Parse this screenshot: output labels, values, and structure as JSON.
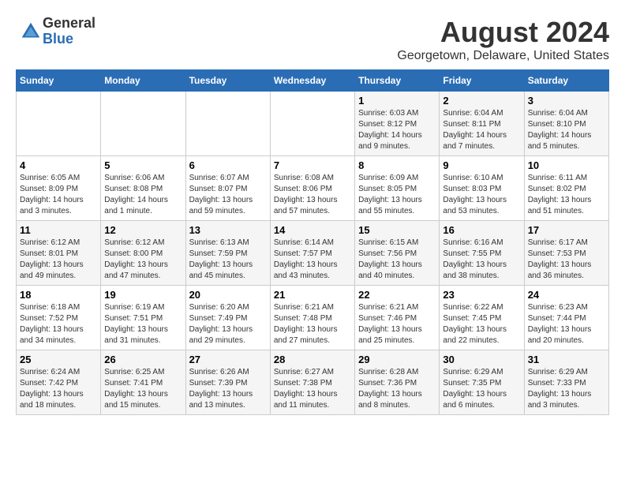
{
  "logo": {
    "general": "General",
    "blue": "Blue"
  },
  "title": {
    "month": "August 2024",
    "location": "Georgetown, Delaware, United States"
  },
  "headers": [
    "Sunday",
    "Monday",
    "Tuesday",
    "Wednesday",
    "Thursday",
    "Friday",
    "Saturday"
  ],
  "weeks": [
    [
      {
        "day": "",
        "info": ""
      },
      {
        "day": "",
        "info": ""
      },
      {
        "day": "",
        "info": ""
      },
      {
        "day": "",
        "info": ""
      },
      {
        "day": "1",
        "info": "Sunrise: 6:03 AM\nSunset: 8:12 PM\nDaylight: 14 hours\nand 9 minutes."
      },
      {
        "day": "2",
        "info": "Sunrise: 6:04 AM\nSunset: 8:11 PM\nDaylight: 14 hours\nand 7 minutes."
      },
      {
        "day": "3",
        "info": "Sunrise: 6:04 AM\nSunset: 8:10 PM\nDaylight: 14 hours\nand 5 minutes."
      }
    ],
    [
      {
        "day": "4",
        "info": "Sunrise: 6:05 AM\nSunset: 8:09 PM\nDaylight: 14 hours\nand 3 minutes."
      },
      {
        "day": "5",
        "info": "Sunrise: 6:06 AM\nSunset: 8:08 PM\nDaylight: 14 hours\nand 1 minute."
      },
      {
        "day": "6",
        "info": "Sunrise: 6:07 AM\nSunset: 8:07 PM\nDaylight: 13 hours\nand 59 minutes."
      },
      {
        "day": "7",
        "info": "Sunrise: 6:08 AM\nSunset: 8:06 PM\nDaylight: 13 hours\nand 57 minutes."
      },
      {
        "day": "8",
        "info": "Sunrise: 6:09 AM\nSunset: 8:05 PM\nDaylight: 13 hours\nand 55 minutes."
      },
      {
        "day": "9",
        "info": "Sunrise: 6:10 AM\nSunset: 8:03 PM\nDaylight: 13 hours\nand 53 minutes."
      },
      {
        "day": "10",
        "info": "Sunrise: 6:11 AM\nSunset: 8:02 PM\nDaylight: 13 hours\nand 51 minutes."
      }
    ],
    [
      {
        "day": "11",
        "info": "Sunrise: 6:12 AM\nSunset: 8:01 PM\nDaylight: 13 hours\nand 49 minutes."
      },
      {
        "day": "12",
        "info": "Sunrise: 6:12 AM\nSunset: 8:00 PM\nDaylight: 13 hours\nand 47 minutes."
      },
      {
        "day": "13",
        "info": "Sunrise: 6:13 AM\nSunset: 7:59 PM\nDaylight: 13 hours\nand 45 minutes."
      },
      {
        "day": "14",
        "info": "Sunrise: 6:14 AM\nSunset: 7:57 PM\nDaylight: 13 hours\nand 43 minutes."
      },
      {
        "day": "15",
        "info": "Sunrise: 6:15 AM\nSunset: 7:56 PM\nDaylight: 13 hours\nand 40 minutes."
      },
      {
        "day": "16",
        "info": "Sunrise: 6:16 AM\nSunset: 7:55 PM\nDaylight: 13 hours\nand 38 minutes."
      },
      {
        "day": "17",
        "info": "Sunrise: 6:17 AM\nSunset: 7:53 PM\nDaylight: 13 hours\nand 36 minutes."
      }
    ],
    [
      {
        "day": "18",
        "info": "Sunrise: 6:18 AM\nSunset: 7:52 PM\nDaylight: 13 hours\nand 34 minutes."
      },
      {
        "day": "19",
        "info": "Sunrise: 6:19 AM\nSunset: 7:51 PM\nDaylight: 13 hours\nand 31 minutes."
      },
      {
        "day": "20",
        "info": "Sunrise: 6:20 AM\nSunset: 7:49 PM\nDaylight: 13 hours\nand 29 minutes."
      },
      {
        "day": "21",
        "info": "Sunrise: 6:21 AM\nSunset: 7:48 PM\nDaylight: 13 hours\nand 27 minutes."
      },
      {
        "day": "22",
        "info": "Sunrise: 6:21 AM\nSunset: 7:46 PM\nDaylight: 13 hours\nand 25 minutes."
      },
      {
        "day": "23",
        "info": "Sunrise: 6:22 AM\nSunset: 7:45 PM\nDaylight: 13 hours\nand 22 minutes."
      },
      {
        "day": "24",
        "info": "Sunrise: 6:23 AM\nSunset: 7:44 PM\nDaylight: 13 hours\nand 20 minutes."
      }
    ],
    [
      {
        "day": "25",
        "info": "Sunrise: 6:24 AM\nSunset: 7:42 PM\nDaylight: 13 hours\nand 18 minutes."
      },
      {
        "day": "26",
        "info": "Sunrise: 6:25 AM\nSunset: 7:41 PM\nDaylight: 13 hours\nand 15 minutes."
      },
      {
        "day": "27",
        "info": "Sunrise: 6:26 AM\nSunset: 7:39 PM\nDaylight: 13 hours\nand 13 minutes."
      },
      {
        "day": "28",
        "info": "Sunrise: 6:27 AM\nSunset: 7:38 PM\nDaylight: 13 hours\nand 11 minutes."
      },
      {
        "day": "29",
        "info": "Sunrise: 6:28 AM\nSunset: 7:36 PM\nDaylight: 13 hours\nand 8 minutes."
      },
      {
        "day": "30",
        "info": "Sunrise: 6:29 AM\nSunset: 7:35 PM\nDaylight: 13 hours\nand 6 minutes."
      },
      {
        "day": "31",
        "info": "Sunrise: 6:29 AM\nSunset: 7:33 PM\nDaylight: 13 hours\nand 3 minutes."
      }
    ]
  ]
}
